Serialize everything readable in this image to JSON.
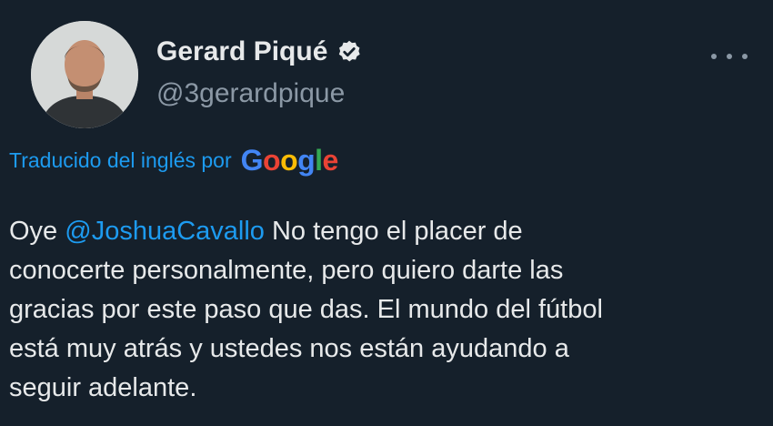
{
  "author": {
    "display_name": "Gerard Piqué",
    "handle": "@3gerardpique",
    "avatar_icon": "profile-photo",
    "verified_icon": "verified-badge-icon"
  },
  "menu": {
    "icon": "more-options-icon"
  },
  "translation": {
    "label": "Traducido del inglés por",
    "provider_letters": [
      "G",
      "o",
      "o",
      "g",
      "l",
      "e"
    ]
  },
  "tweet": {
    "line1": {
      "before": "Oye ",
      "mention": "@JoshuaCavallo",
      "after": " No tengo el placer de"
    },
    "line2": "conocerte personalmente, pero quiero darte las",
    "line3": "gracias por este paso que das. El mundo del fútbol",
    "line4": "está muy atrás y ustedes nos están ayudando a",
    "line5": "seguir adelante."
  },
  "colors": {
    "background": "#15202b",
    "text": "#e7e9ea",
    "secondary_text": "#8b98a5",
    "link": "#1d9bf0"
  }
}
